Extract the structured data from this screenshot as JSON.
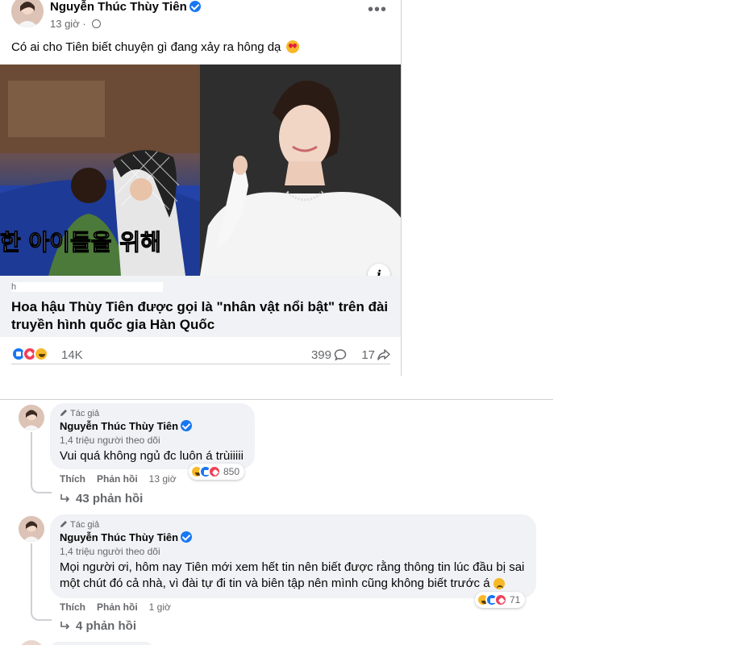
{
  "post": {
    "author": "Nguyễn Thúc Thùy Tiên",
    "time": "13 giờ",
    "text": "Có ai cho Tiên biết chuyện gì đang xảy ra hông dạ",
    "link": {
      "domain": "h",
      "title": "Hoa hậu Thùy Tiên được gọi là \"nhân vật nổi bật\" trên đài truyền hình quốc gia Hàn Quốc"
    },
    "reactions_count": "14K",
    "comments_count": "399",
    "shares_count": "17"
  },
  "comments": [
    {
      "author_tag": "Tác giả",
      "name": "Nguyễn Thúc Thùy Tiên",
      "followers": "1,4 triệu người theo dõi",
      "text": "Vui quá không ngủ đc luôn á trùiiiii",
      "reactions_count": "850",
      "like_label": "Thích",
      "reply_label": "Phản hồi",
      "time": "13 giờ",
      "replies": "43 phản hồi"
    },
    {
      "author_tag": "Tác giả",
      "name": "Nguyễn Thúc Thùy Tiên",
      "followers": "1,4 triệu người theo dõi",
      "text": "Mọi người ơi, hôm nay Tiên mới xem hết tin nên biết được rằng thông tin lúc đầu bị sai một chút đó cả nhà, vì đài tự đi tin và biên tập nên mình cũng không biết trước á",
      "reactions_count": "71",
      "like_label": "Thích",
      "reply_label": "Phản hồi",
      "time": "1 giờ",
      "replies": "4 phản hồi"
    }
  ],
  "colors": {
    "accent": "#1877f2",
    "text_primary": "#050505",
    "text_secondary": "#65676b",
    "bubble_bg": "#f0f2f5",
    "love": "#f33e58",
    "haha": "#f7b928"
  },
  "icons": [
    "verified-icon",
    "globe-icon",
    "more-icon",
    "info-icon",
    "like-icon",
    "love-icon",
    "haha-icon",
    "comment-icon",
    "share-icon",
    "pen-icon",
    "reply-arrow-icon"
  ]
}
